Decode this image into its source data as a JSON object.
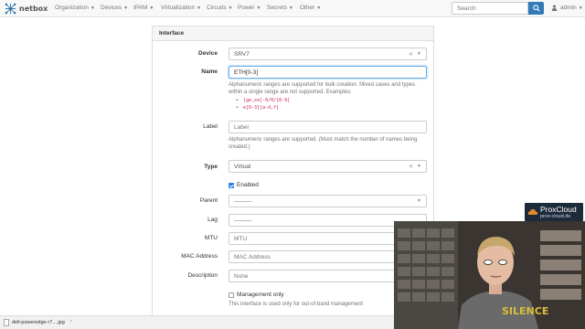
{
  "navbar": {
    "brand": "netbox",
    "menu": [
      {
        "label": "Organization",
        "left": 0
      },
      {
        "label": "Devices"
      },
      {
        "label": "IPAM"
      },
      {
        "label": "Virtualization"
      },
      {
        "label": "Circuits"
      },
      {
        "label": "Power"
      },
      {
        "label": "Secrets"
      },
      {
        "label": "Other"
      }
    ],
    "search_placeholder": "Search",
    "user": "admin"
  },
  "panel": {
    "title": "Interface",
    "device": {
      "label": "Device",
      "value": "SRV7"
    },
    "name": {
      "label": "Name",
      "value": "ETH[0-3]"
    },
    "name_help": "Alphanumeric ranges are supported for bulk creation. Mixed cases and types within a single range are not supported. Examples:",
    "name_examples": [
      "[ge,xe]-0/0/[0-9]",
      "e[0-3][a-d,f]"
    ],
    "label": {
      "label": "Label",
      "placeholder": "Label"
    },
    "label_help": "Alphanumeric ranges are supported. (Must match the number of names being created.)",
    "type": {
      "label": "Type",
      "value": "Virtual"
    },
    "enabled": "Enabled",
    "parent": {
      "label": "Parent",
      "value": "---------"
    },
    "lag": {
      "label": "Lag",
      "value": "---------"
    },
    "mtu": {
      "label": "MTU",
      "placeholder": "MTU"
    },
    "mac": {
      "label": "MAC Address",
      "placeholder": "MAC Address"
    },
    "description": {
      "label": "Description",
      "placeholder": "None"
    },
    "mgmt_only": "Management only",
    "mgmt_help": "This interface is used only for out-of-band management"
  },
  "downloads": {
    "file": "dell-poweredge-r7....jpg"
  },
  "overlay": {
    "logo_name": "ProxCloud",
    "logo_url": "prox-cloud.de"
  },
  "colors": {
    "accent": "#337ab7",
    "focus": "#66afe9",
    "code": "#c7254e",
    "logo_bg": "#1d2a3a"
  }
}
